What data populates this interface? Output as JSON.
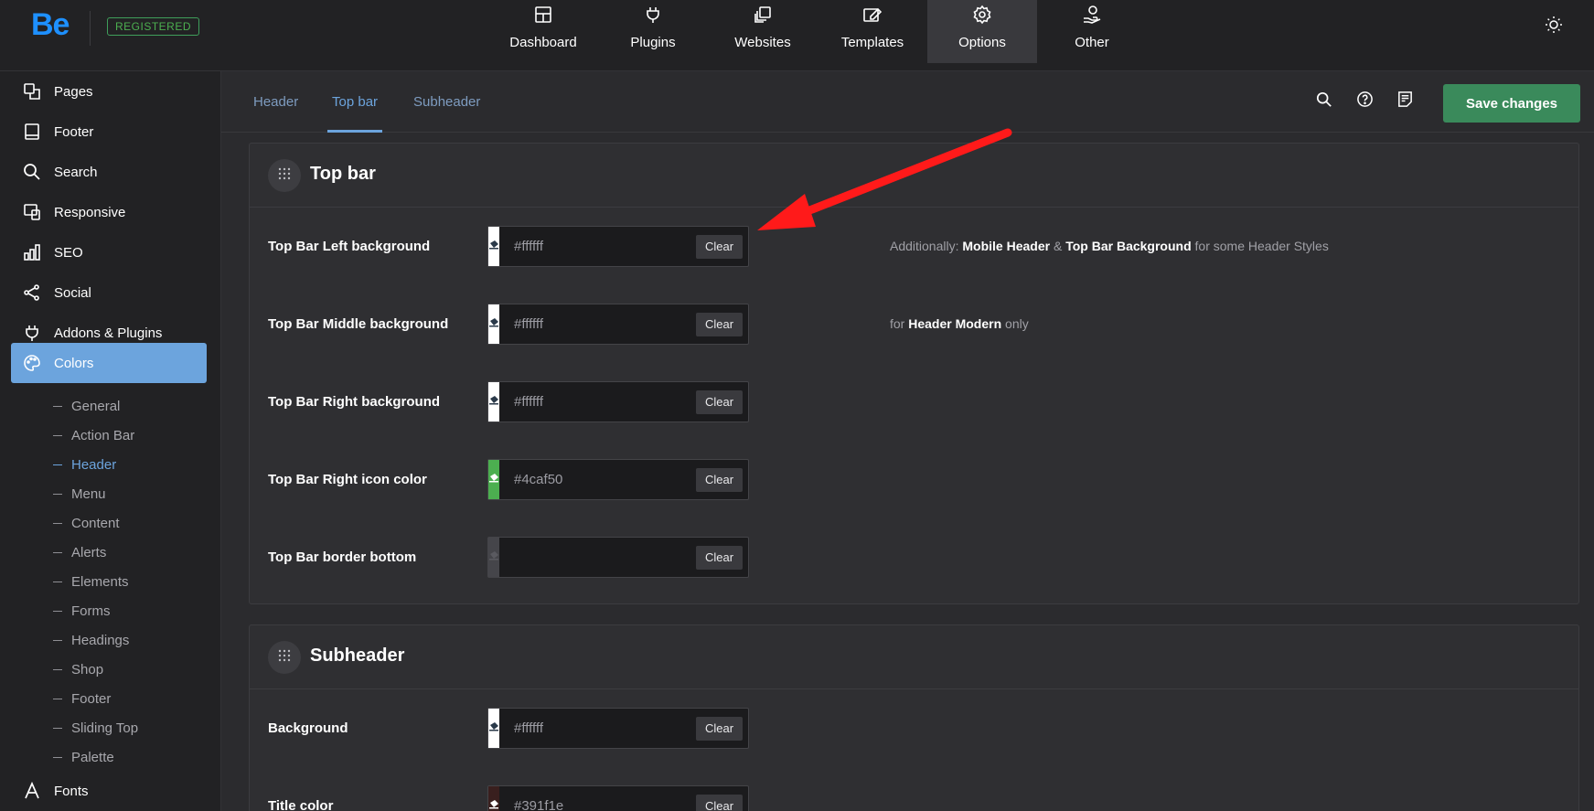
{
  "brand": {
    "logo": "Be",
    "badge": "REGISTERED"
  },
  "topnav": {
    "items": [
      {
        "label": "Dashboard",
        "icon": "dashboard-icon"
      },
      {
        "label": "Plugins",
        "icon": "plug-icon"
      },
      {
        "label": "Websites",
        "icon": "websites-icon"
      },
      {
        "label": "Templates",
        "icon": "templates-icon"
      },
      {
        "label": "Options",
        "icon": "gear-icon",
        "active": true
      },
      {
        "label": "Other",
        "icon": "other-icon"
      }
    ],
    "theme_icon": "sun-icon"
  },
  "sidebar": {
    "items": [
      {
        "label": "Pages",
        "icon": "pages-icon"
      },
      {
        "label": "Footer",
        "icon": "footer-icon"
      },
      {
        "label": "Search",
        "icon": "search-icon"
      },
      {
        "label": "Responsive",
        "icon": "responsive-icon"
      },
      {
        "label": "SEO",
        "icon": "seo-icon"
      },
      {
        "label": "Social",
        "icon": "share-icon"
      },
      {
        "label": "Addons & Plugins",
        "icon": "plug-icon"
      },
      {
        "label": "Colors",
        "icon": "palette-icon",
        "active": true
      }
    ],
    "subitems": [
      {
        "label": "General"
      },
      {
        "label": "Action Bar"
      },
      {
        "label": "Header",
        "active": true
      },
      {
        "label": "Menu"
      },
      {
        "label": "Content"
      },
      {
        "label": "Alerts"
      },
      {
        "label": "Elements"
      },
      {
        "label": "Forms"
      },
      {
        "label": "Headings"
      },
      {
        "label": "Shop"
      },
      {
        "label": "Footer"
      },
      {
        "label": "Sliding Top"
      },
      {
        "label": "Palette"
      }
    ],
    "bottom_item": {
      "label": "Fonts",
      "icon": "font-icon"
    }
  },
  "tabs": [
    {
      "label": "Header"
    },
    {
      "label": "Top bar",
      "active": true
    },
    {
      "label": "Subheader"
    }
  ],
  "toolbar": {
    "save_label": "Save changes"
  },
  "panels": [
    {
      "title": "Top bar",
      "rows": [
        {
          "label": "Top Bar Left background",
          "value": "#ffffff",
          "swatch": "#ffffff",
          "clear": "Clear"
        },
        {
          "label": "Top Bar Middle background",
          "value": "#ffffff",
          "swatch": "#ffffff",
          "clear": "Clear"
        },
        {
          "label": "Top Bar Right background",
          "value": "#ffffff",
          "swatch": "#ffffff",
          "clear": "Clear"
        },
        {
          "label": "Top Bar Right icon color",
          "value": "#4caf50",
          "swatch": "#4caf50",
          "clear": "Clear"
        },
        {
          "label": "Top Bar border bottom",
          "value": "",
          "swatch": "#45454a",
          "clear": "Clear"
        }
      ],
      "notes": {
        "row1": {
          "pre": "Additionally: ",
          "b1": "Mobile Header",
          "mid": " & ",
          "b2": "Top Bar Background",
          "post": " for some Header Styles"
        },
        "row2": {
          "pre": "for ",
          "b1": "Header Modern",
          "post": " only"
        }
      }
    },
    {
      "title": "Subheader",
      "rows": [
        {
          "label": "Background",
          "value": "#ffffff",
          "swatch": "#ffffff",
          "clear": "Clear"
        },
        {
          "label": "Title color",
          "value": "#391f1e",
          "swatch": "#391f1e",
          "clear": "Clear"
        }
      ]
    }
  ],
  "colors": {
    "accent": "#6ca4dd",
    "save": "#3a8a5b",
    "annotation_arrow": "#ff1a1a",
    "logo": "#1e90ff"
  }
}
